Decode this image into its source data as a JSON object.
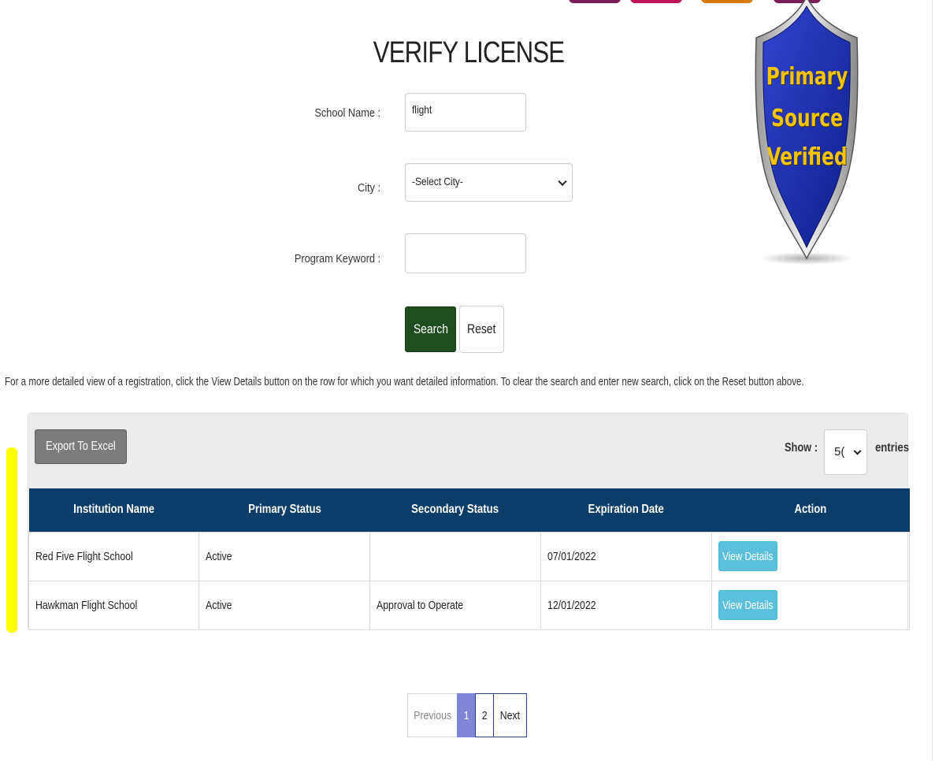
{
  "page_title": "VERIFY LICENSE",
  "form": {
    "school_name_label": "School Name :",
    "school_name_value": "flight",
    "city_label": "City :",
    "city_selected": "-Select City-",
    "program_label": "Program Keyword :",
    "program_value": "",
    "search_label": "Search",
    "reset_label": "Reset"
  },
  "badge": {
    "line1": "Primary",
    "line2": "Source",
    "line3": "Verified"
  },
  "info_text": "For a more detailed view of a registration, click the View Details button on the row for which you want detailed information. To clear the search and enter new search, click on the Reset button above.",
  "toolbar": {
    "export_label": "Export To Excel",
    "show_label": "Show :",
    "show_value": "5(",
    "entries_label": "entries"
  },
  "table": {
    "headers": [
      "Institution Name",
      "Primary Status",
      "Secondary Status",
      "Expiration Date",
      "Action"
    ],
    "rows": [
      {
        "institution": "Red Five Flight School",
        "primary": "Active",
        "secondary": "",
        "expiration": "07/01/2022",
        "action": "View Details"
      },
      {
        "institution": "Hawkman Flight School",
        "primary": "Active",
        "secondary": "Approval to Operate",
        "expiration": "12/01/2022",
        "action": "View Details"
      }
    ]
  },
  "pagination": {
    "previous": "Previous",
    "pages": [
      "1",
      "2"
    ],
    "active_page": "1",
    "next": "Next"
  },
  "colors": {
    "header_bg": "#0b3d6b",
    "search_btn": "#1f4e1e",
    "view_btn": "#5bc0de",
    "active_page": "#7f86d6",
    "badge_shield": "#1a2fb0",
    "badge_text": "#f4c400",
    "highlight": "#ffff00"
  }
}
